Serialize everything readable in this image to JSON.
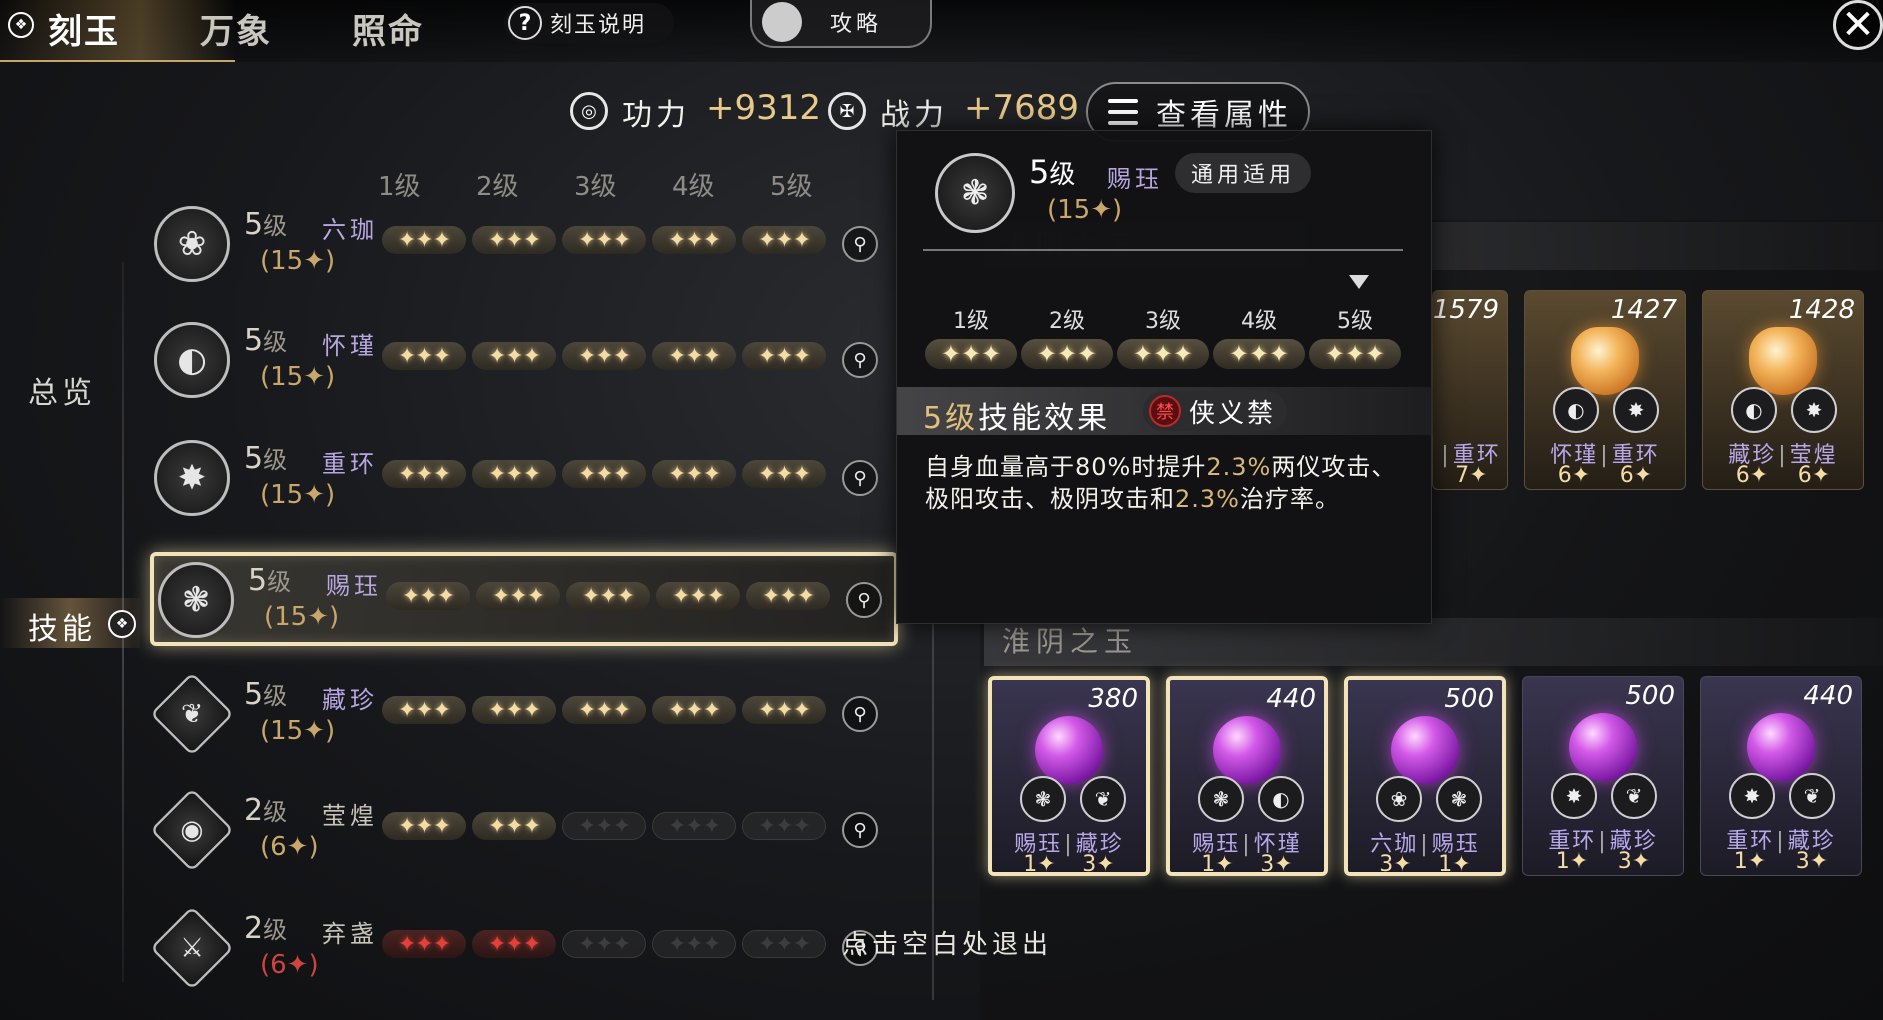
{
  "nav": {
    "tabs": [
      "刻玉",
      "万象",
      "照命"
    ],
    "help_label": "刻玉说明",
    "guide_label": "攻略",
    "close": "✕"
  },
  "stats": {
    "gongli_label": "功力",
    "gongli_value": "+9312",
    "zhanli_label": "战力",
    "zhanli_value": "+7689",
    "view_attr_label": "查看属性"
  },
  "sidebar": {
    "overview": "总览",
    "skill": "技能"
  },
  "level_headers": [
    "1级",
    "2级",
    "3级",
    "4级",
    "5级"
  ],
  "rows": [
    {
      "level": "5",
      "level_unit": "级",
      "name": "六珈",
      "count": "(15✦)",
      "tiers": [
        "gold",
        "gold",
        "gold",
        "gold",
        "gold"
      ],
      "icon": "❀",
      "icon_name": "sprout-icon"
    },
    {
      "level": "5",
      "level_unit": "级",
      "name": "怀瑾",
      "count": "(15✦)",
      "tiers": [
        "gold",
        "gold",
        "gold",
        "gold",
        "gold"
      ],
      "icon": "◐",
      "icon_name": "shield-icon"
    },
    {
      "level": "5",
      "level_unit": "级",
      "name": "重环",
      "count": "(15✦)",
      "tiers": [
        "gold",
        "gold",
        "gold",
        "gold",
        "gold"
      ],
      "icon": "✸",
      "icon_name": "burst-sword-icon"
    },
    {
      "level": "5",
      "level_unit": "级",
      "name": "赐珏",
      "count": "(15✦)",
      "tiers": [
        "gold",
        "gold",
        "gold",
        "gold",
        "gold"
      ],
      "icon": "❃",
      "icon_name": "fruit-icon"
    },
    {
      "level": "5",
      "level_unit": "级",
      "name": "藏珍",
      "count": "(15✦)",
      "tiers": [
        "gold",
        "gold",
        "gold",
        "gold",
        "gold"
      ],
      "icon": "❦",
      "icon_name": "phoenix-icon"
    },
    {
      "level": "2",
      "level_unit": "级",
      "name": "莹煌",
      "count": "(6✦)",
      "tiers": [
        "gold",
        "gold",
        "empty",
        "empty",
        "empty"
      ],
      "icon": "◉",
      "icon_name": "shield-emblem-icon"
    },
    {
      "level": "2",
      "level_unit": "级",
      "name": "弃盏",
      "count": "(6✦)",
      "tiers": [
        "red",
        "red",
        "empty",
        "empty",
        "empty"
      ],
      "icon": "⚔",
      "icon_name": "crossed-swords-icon"
    }
  ],
  "tier_glyph": "✦✦✦",
  "section_dim": "淮阴之玉",
  "section_title": "淮阴之玉",
  "top_cards": [
    {
      "score": "1579",
      "names": [
        "",
        "重环"
      ],
      "stars": [
        "",
        "7✦"
      ],
      "gem": "amber",
      "partial": true
    },
    {
      "score": "1427",
      "names": [
        "怀瑾",
        "重环"
      ],
      "stars": [
        "6✦",
        "6✦"
      ],
      "gem": "amber"
    },
    {
      "score": "1428",
      "names": [
        "藏珍",
        "莹煌"
      ],
      "stars": [
        "6✦",
        "6✦"
      ],
      "gem": "amber"
    }
  ],
  "bottom_cards": [
    {
      "score": "380",
      "names": [
        "赐珏",
        "藏珍"
      ],
      "stars": [
        "1✦",
        "3✦"
      ],
      "highlight": true,
      "icons": [
        "❃",
        "❦"
      ]
    },
    {
      "score": "440",
      "names": [
        "赐珏",
        "怀瑾"
      ],
      "stars": [
        "1✦",
        "3✦"
      ],
      "highlight": true,
      "icons": [
        "❃",
        "◐"
      ]
    },
    {
      "score": "500",
      "names": [
        "六珈",
        "赐珏"
      ],
      "stars": [
        "3✦",
        "1✦"
      ],
      "highlight": true,
      "icons": [
        "❀",
        "❃"
      ]
    },
    {
      "score": "500",
      "names": [
        "重环",
        "藏珍"
      ],
      "stars": [
        "1✦",
        "3✦"
      ],
      "highlight": false,
      "icons": [
        "✸",
        "❦"
      ]
    },
    {
      "score": "440",
      "names": [
        "重环",
        "藏珍"
      ],
      "stars": [
        "1✦",
        "3✦"
      ],
      "highlight": false,
      "icons": [
        "✸",
        "❦"
      ]
    }
  ],
  "popup": {
    "level": "5",
    "level_unit": "级",
    "name": "赐珏",
    "tag": "通用适用",
    "count": "(15✦)",
    "level_headers": [
      "1级",
      "2级",
      "3级",
      "4级",
      "5级"
    ],
    "effect_level": "5级",
    "effect_title": "技能效果",
    "ban_icon": "禁",
    "ban_label": "侠义禁",
    "desc_parts": [
      {
        "t": "自身血量高于80%时提升",
        "hl": false
      },
      {
        "t": "2.3%",
        "hl": true
      },
      {
        "t": "两仪攻击、极阳攻击、极阴攻击和",
        "hl": false
      },
      {
        "t": "2.3%",
        "hl": true
      },
      {
        "t": "治疗率。",
        "hl": false
      }
    ]
  },
  "exit_hint": "点击空白处退出",
  "colors": {
    "gold": "#e9c98a",
    "purple_name": "#b7a6e0",
    "red_tier": "#e3403a",
    "highlight": "#d6b777"
  }
}
